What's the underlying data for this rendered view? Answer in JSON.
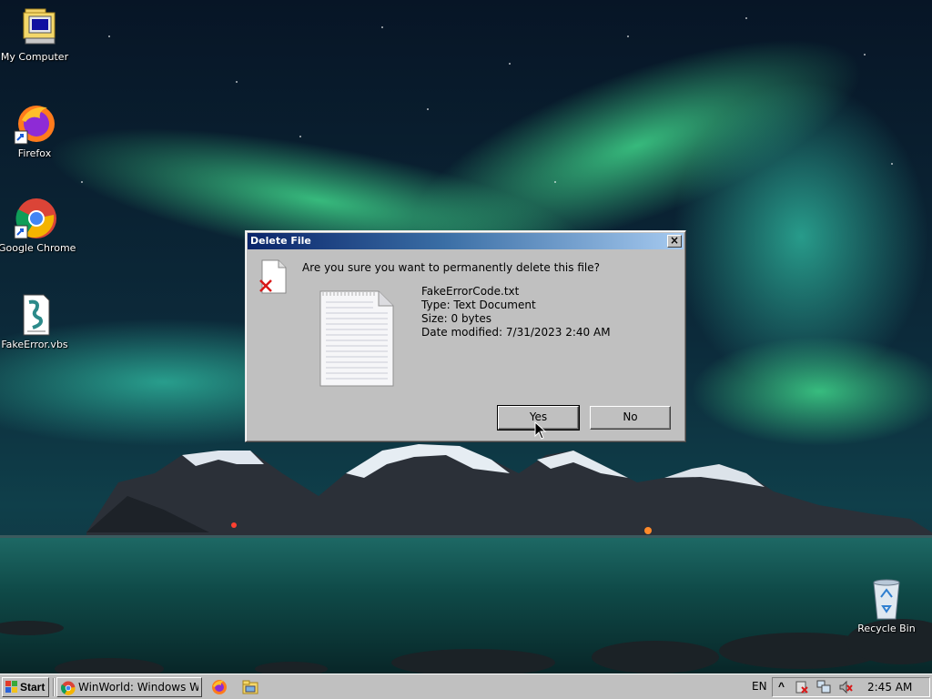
{
  "desktop": {
    "icons": [
      {
        "label": "My Computer",
        "icon": "my-computer-icon"
      },
      {
        "label": "Firefox",
        "icon": "firefox-icon"
      },
      {
        "label": "Google Chrome",
        "icon": "chrome-icon"
      },
      {
        "label": "FakeError.vbs",
        "icon": "vbs-script-icon"
      },
      {
        "label": "Recycle Bin",
        "icon": "recycle-bin-icon"
      }
    ]
  },
  "dialog": {
    "title": "Delete File",
    "close_label": "×",
    "question": "Are you sure you want to permanently delete this file?",
    "file_name": "FakeErrorCode.txt",
    "file_type": "Type: Text Document",
    "file_size": "Size: 0 bytes",
    "file_modified": "Date modified: 7/31/2023 2:40 AM",
    "yes_label": "Yes",
    "no_label": "No"
  },
  "taskbar": {
    "start_label": "Start",
    "task_label": "WinWorld: Windows Whi...",
    "language": "EN",
    "clock": "2:45 AM",
    "tray_chevron": "^"
  },
  "colors": {
    "title_gradient_start": "#0a246a",
    "title_gradient_end": "#a6caf0",
    "face": "#c0c0c0"
  }
}
